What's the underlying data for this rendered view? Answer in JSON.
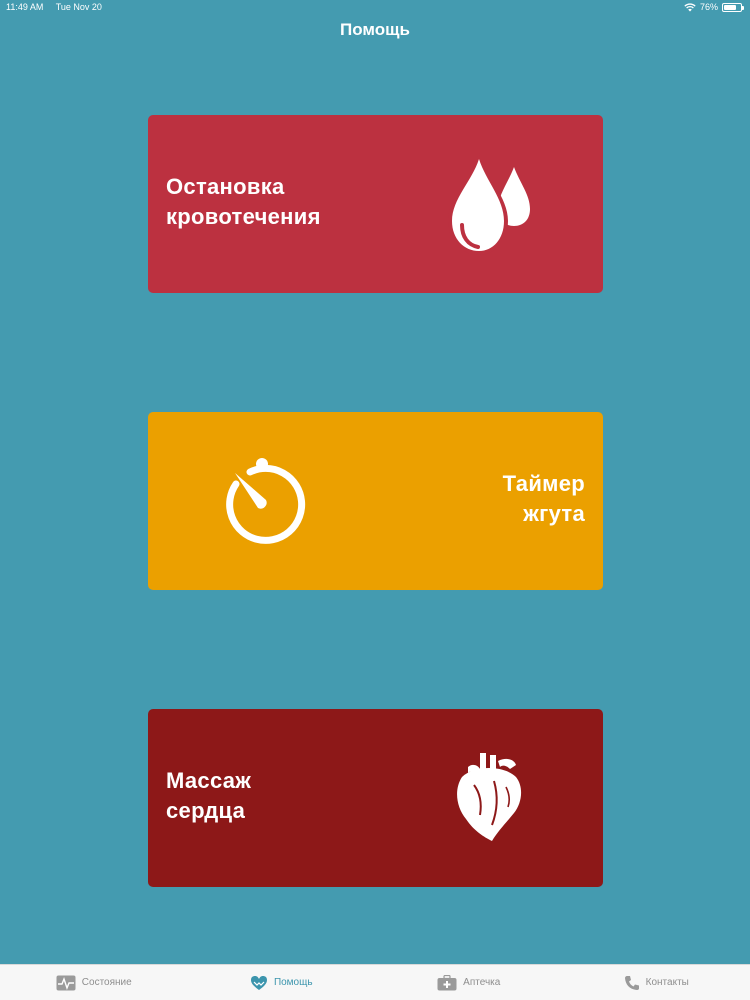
{
  "status_bar": {
    "time": "11:49 AM",
    "date": "Tue Nov 20",
    "battery": "76%",
    "battery_level": 0.76
  },
  "nav": {
    "title": "Помощь"
  },
  "cards": [
    {
      "line1": "Остановка",
      "line2": "кровотечения",
      "icon": "blood-drops-icon",
      "color": "#bc3140"
    },
    {
      "line1": "Таймер",
      "line2": "жгута",
      "icon": "stopwatch-icon",
      "color": "#eba000"
    },
    {
      "line1": "Массаж",
      "line2": "сердца",
      "icon": "heart-icon",
      "color": "#8d1818"
    }
  ],
  "tabs": [
    {
      "label": "Состояние",
      "icon": "heartbeat-monitor-icon",
      "active": false
    },
    {
      "label": "Помощь",
      "icon": "heart-hands-icon",
      "active": true
    },
    {
      "label": "Аптечка",
      "icon": "first-aid-kit-icon",
      "active": false
    },
    {
      "label": "Контакты",
      "icon": "phone-icon",
      "active": false
    }
  ],
  "colors": {
    "background": "#449bb0",
    "tab_active": "#3c95ad",
    "tab_inactive": "#8e8e8e"
  }
}
